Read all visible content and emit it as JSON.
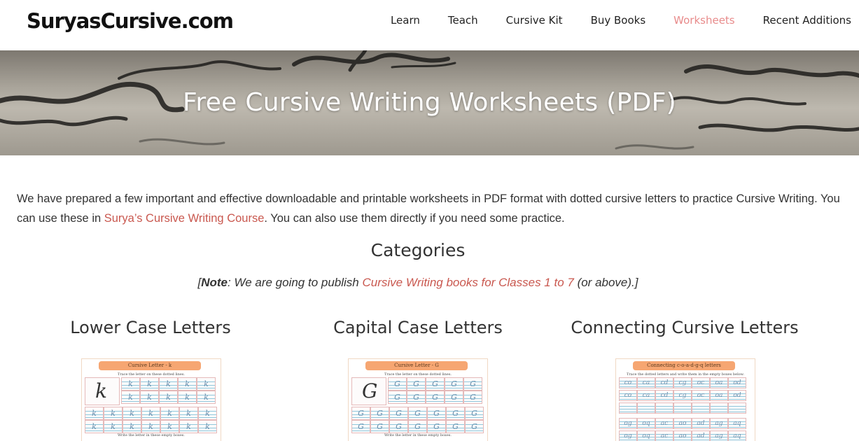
{
  "header": {
    "logo": "SuryasCursive.com",
    "nav": [
      {
        "label": "Learn",
        "active": false
      },
      {
        "label": "Teach",
        "active": false
      },
      {
        "label": "Cursive Kit",
        "active": false
      },
      {
        "label": "Buy Books",
        "active": false
      },
      {
        "label": "Worksheets",
        "active": true
      },
      {
        "label": "Recent Additions",
        "active": false
      }
    ],
    "active_color": "#e88b8b"
  },
  "hero": {
    "title": "Free Cursive Writing Worksheets (PDF)"
  },
  "intro": {
    "text_before": "We have prepared a few important and effective downloadable and printable worksheets in PDF format with dotted cursive letters to practice Cursive Writing. You can use these in ",
    "link": "Surya’s Cursive Writing Course",
    "text_after": ". You can also use them directly if you need some practice.",
    "link_color": "#c9584f"
  },
  "categories_heading": "Categories",
  "note": {
    "open": "[",
    "label": "Note",
    "text": ": We are going to publish ",
    "link": "Cursive Writing books for Classes 1 to 7",
    "tail": " (or above).]"
  },
  "columns": [
    {
      "title": "Lower Case Letters",
      "thumb_title": "Cursive Letter - k",
      "thumb_sub": "Trace the letter on these dotted lines.",
      "thumb_bottom": "Write the letter in these empty boxes.",
      "big": "k",
      "glyph": "k"
    },
    {
      "title": "Capital Case Letters",
      "thumb_title": "Cursive Letter - G",
      "thumb_sub": "Trace the letter on these dotted lines.",
      "thumb_bottom": "Write the letter in these empty boxes.",
      "big": "G",
      "glyph": "G"
    },
    {
      "title": "Connecting Cursive Letters",
      "thumb_title": "Connecting c-o-a-d-g-q letters",
      "thumb_sub": "Trace the dotted letters and write them in the empty boxes below.",
      "thumb_bottom": "",
      "pairs_row1": [
        "co",
        "ca",
        "cd",
        "cg",
        "oc",
        "oa",
        "od"
      ],
      "pairs_row2": [
        "og",
        "oq",
        "ac",
        "ao",
        "ad",
        "ag",
        "aq"
      ]
    }
  ]
}
